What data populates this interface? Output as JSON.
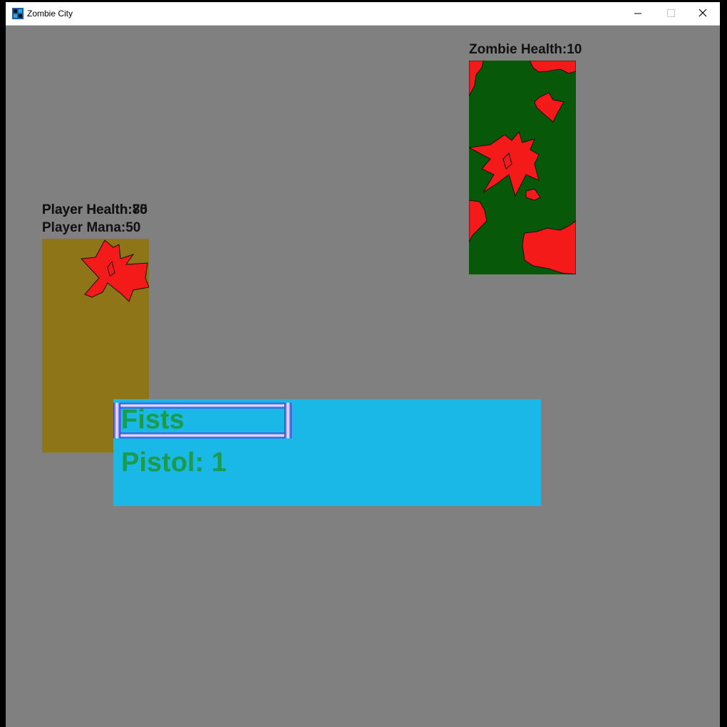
{
  "window": {
    "title": "Zombie City",
    "controls": {
      "minimize": "—",
      "maximize": "☐",
      "close": "✕"
    }
  },
  "zombie": {
    "health_text": "Zombie Health:10",
    "body_color": "#085809",
    "blood_color": "#f51a1a"
  },
  "player": {
    "health_text_a": "Player Health:75",
    "health_text_b": "Player Health:80",
    "mana_text": "Player Mana:50",
    "body_color": "#8e7518",
    "blood_color": "#f51a1a"
  },
  "weapons": {
    "items": [
      {
        "label": "Fists",
        "selected": true
      },
      {
        "label": "Pistol: 1",
        "selected": false
      }
    ],
    "panel_color": "#1ab8e6",
    "text_color": "#1a9b4e"
  }
}
